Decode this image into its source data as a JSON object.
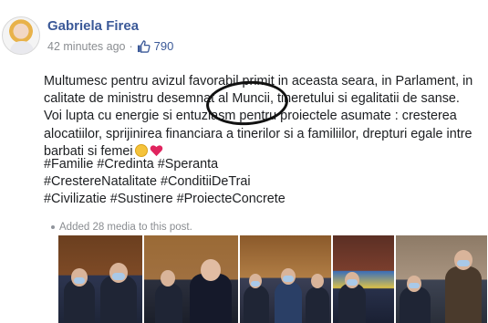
{
  "post": {
    "author": "Gabriela Firea",
    "time": "42 minutes ago",
    "separator": "·",
    "likes": "790",
    "text_lines": [
      "Multumesc pentru avizul favorabil primit in aceasta seara, in Parlament, in",
      "calitate de ministru desemnat al Muncii, tineretului si egalitatii de sanse.",
      "Voi lupta cu energie si entuziasm pentru proiectele asumate : cresterea",
      "alocatiilor, sprijinirea financiara a tinerilor si a familiilor, drepturi egale intre",
      "barbati si femei"
    ],
    "hashtags": [
      "#Familie #Credinta #Speranta",
      "#CrestereNatalitate #ConditiiDeTrai",
      "#Civilizatie #Sustinere #ProiecteConcrete"
    ],
    "added_media": "Added 28 media to this post.",
    "icons": {
      "like": "thumbs-up-icon",
      "hug": "hug-emoji-icon",
      "heart": "heart-emoji-icon"
    },
    "colors": {
      "author": "#3b5998",
      "meta": "#8a8d91",
      "heart": "#e0245e"
    }
  }
}
